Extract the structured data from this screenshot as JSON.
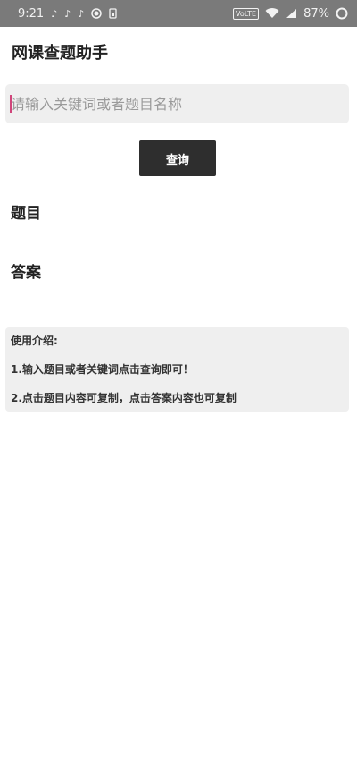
{
  "status_bar": {
    "time": "9:21",
    "volte": "VoLTE",
    "battery": "87%",
    "icons": [
      "tiktok-icon",
      "tiktok-icon",
      "tiktok-icon",
      "circle-record-icon",
      "sim-card-icon",
      "wifi-icon",
      "signal-icon",
      "battery-ring-icon"
    ]
  },
  "app": {
    "title": "网课查题助手"
  },
  "search": {
    "value": "",
    "placeholder": "请输入关键词或者题目名称"
  },
  "query_button": {
    "label": "查询"
  },
  "sections": {
    "question_label": "题目",
    "answer_label": "答案"
  },
  "instructions": {
    "title": "使用介绍:",
    "step1": "1.输入题目或者关键词点击查询即可！",
    "step2": "2.点击题目内容可复制，点击答案内容也可复制"
  },
  "colors": {
    "status_bar_bg": "#7a7a7a",
    "input_bg": "#efefef",
    "button_bg": "#2e2e2e",
    "caret": "#d0457a"
  }
}
